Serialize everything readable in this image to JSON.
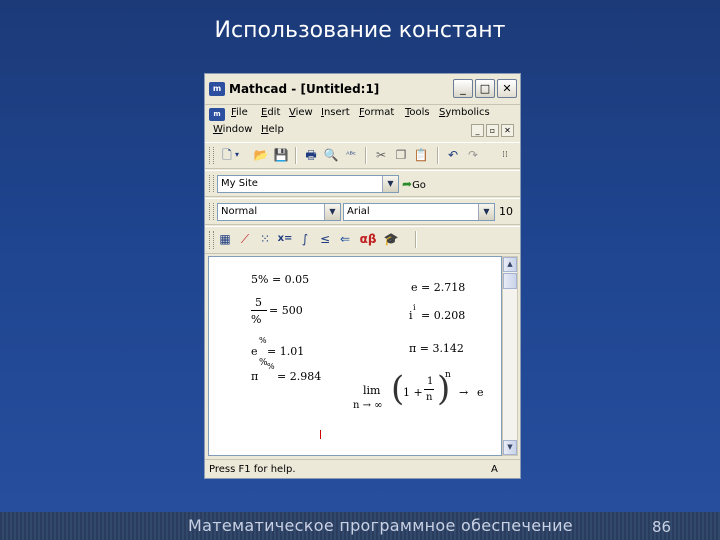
{
  "slide": {
    "title": "Использование констант",
    "footer": "Математическое программное обеспечение",
    "page_number": "86"
  },
  "window": {
    "icon_text": "m",
    "title": "Mathcad - [Untitled:1]",
    "controls": {
      "minimize": "_",
      "maximize": "□",
      "close": "✕"
    },
    "doc_controls": {
      "minimize": "_",
      "restore": "▫",
      "close": "✕"
    },
    "menu": [
      "File",
      "Edit",
      "View",
      "Insert",
      "Format",
      "Tools",
      "Symbolics",
      "Window",
      "Help"
    ],
    "toolbar_icons": [
      "new-doc-icon",
      "open-folder-icon",
      "save-icon",
      "print-icon",
      "print-preview-icon",
      "spellcheck-icon",
      "cut-icon",
      "copy-icon",
      "paste-icon",
      "undo-icon",
      "redo-icon"
    ],
    "resource": {
      "value": "My Site",
      "go_label": "Go"
    },
    "format": {
      "style": "Normal",
      "font": "Arial",
      "size": "10"
    },
    "math_palette": [
      "calculator-icon",
      "graph-icon",
      "matrix-icon",
      "evaluation-icon",
      "calculus-icon",
      "boolean-icon",
      "programming-icon",
      "greek-icon",
      "symbolic-icon"
    ],
    "status": {
      "message": "Press F1 for help.",
      "mode": "A"
    }
  },
  "worksheet": {
    "left": {
      "eq1": "5% = 0.05",
      "frac_num": "5",
      "frac_den": "%",
      "frac_result": "= 500",
      "exp_base": "e",
      "exp_sup": "%",
      "exp_result": "= 1.01",
      "pi_base": "π",
      "pi_sup": "%",
      "pi_result": "= 2.984"
    },
    "right": {
      "e_value": "e = 2.718",
      "i_base": "i",
      "i_sup": "i",
      "i_result": "= 0.208",
      "pi_value": "π = 3.142"
    },
    "limit": {
      "lim": "lim",
      "under": "n → ∞",
      "one_plus": "1 +",
      "num": "1",
      "den": "n",
      "power": "n",
      "arrow": "→",
      "result": "e"
    }
  }
}
